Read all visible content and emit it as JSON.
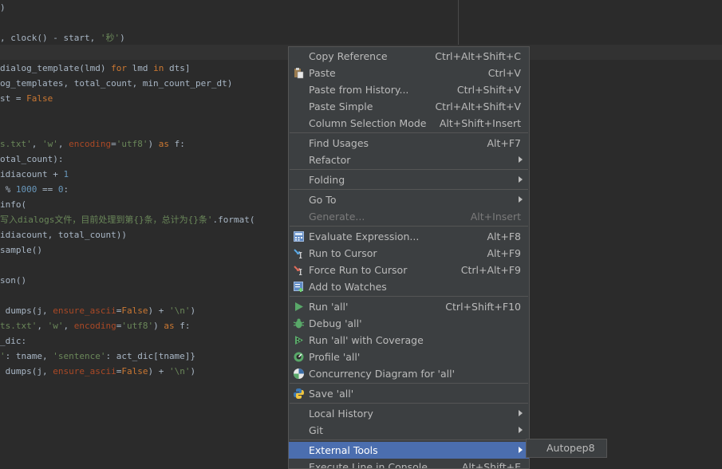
{
  "code_lines": [
    [
      {
        "t": ")",
        "c": "op"
      }
    ],
    [],
    [
      {
        "t": ", clock() - start, ",
        "c": "op"
      },
      {
        "t": "'秒'",
        "c": "str"
      },
      {
        "t": ")",
        "c": "op"
      }
    ],
    [],
    [
      {
        "t": "dialog_template(lmd) ",
        "c": "op"
      },
      {
        "t": "for",
        "c": "kw"
      },
      {
        "t": " lmd ",
        "c": "op"
      },
      {
        "t": "in",
        "c": "kw"
      },
      {
        "t": " dts]",
        "c": "op"
      }
    ],
    [
      {
        "t": "og_templates, total_count, min_count_per_dt)",
        "c": "op"
      }
    ],
    [
      {
        "t": "st = ",
        "c": "op"
      },
      {
        "t": "False",
        "c": "kw"
      }
    ],
    [],
    [],
    [
      {
        "t": "s.txt'",
        "c": "str"
      },
      {
        "t": ", ",
        "c": "op"
      },
      {
        "t": "'w'",
        "c": "str"
      },
      {
        "t": ", ",
        "c": "op"
      },
      {
        "t": "encoding",
        "c": "kwarg"
      },
      {
        "t": "=",
        "c": "op"
      },
      {
        "t": "'utf8'",
        "c": "str"
      },
      {
        "t": ") ",
        "c": "op"
      },
      {
        "t": "as",
        "c": "kw"
      },
      {
        "t": " f:",
        "c": "op"
      }
    ],
    [
      {
        "t": "otal_count):",
        "c": "op"
      }
    ],
    [
      {
        "t": "idiacount + ",
        "c": "op"
      },
      {
        "t": "1",
        "c": "num"
      }
    ],
    [
      {
        "t": " % ",
        "c": "op"
      },
      {
        "t": "1000",
        "c": "num"
      },
      {
        "t": " == ",
        "c": "op"
      },
      {
        "t": "0",
        "c": "num"
      },
      {
        "t": ":",
        "c": "op"
      }
    ],
    [
      {
        "t": "info(",
        "c": "op"
      }
    ],
    [
      {
        "t": "写入dialogs文件，目前处理到第{}条，总计为{}条'",
        "c": "str"
      },
      {
        "t": ".format(",
        "c": "op"
      }
    ],
    [
      {
        "t": "idiacount, total_count))",
        "c": "op"
      }
    ],
    [
      {
        "t": "sample()",
        "c": "op"
      }
    ],
    [],
    [
      {
        "t": "son()",
        "c": "op"
      }
    ],
    [],
    [
      {
        "t": " dumps(j, ",
        "c": "op"
      },
      {
        "t": "ensure_ascii",
        "c": "kwarg"
      },
      {
        "t": "=",
        "c": "op"
      },
      {
        "t": "False",
        "c": "kw"
      },
      {
        "t": ") + ",
        "c": "op"
      },
      {
        "t": "'\\n'",
        "c": "str"
      },
      {
        "t": ")",
        "c": "op"
      }
    ],
    [
      {
        "t": "ts.txt'",
        "c": "str"
      },
      {
        "t": ", ",
        "c": "op"
      },
      {
        "t": "'w'",
        "c": "str"
      },
      {
        "t": ", ",
        "c": "op"
      },
      {
        "t": "encoding",
        "c": "kwarg"
      },
      {
        "t": "=",
        "c": "op"
      },
      {
        "t": "'utf8'",
        "c": "str"
      },
      {
        "t": ") ",
        "c": "op"
      },
      {
        "t": "as",
        "c": "kw"
      },
      {
        "t": " f:",
        "c": "op"
      }
    ],
    [
      {
        "t": "_dic:",
        "c": "op"
      }
    ],
    [
      {
        "t": "'",
        "c": "str"
      },
      {
        "t": ": tname, ",
        "c": "op"
      },
      {
        "t": "'sentence'",
        "c": "str"
      },
      {
        "t": ": act_dic[tname]}",
        "c": "op"
      }
    ],
    [
      {
        "t": " dumps(j, ",
        "c": "op"
      },
      {
        "t": "ensure_ascii",
        "c": "kwarg"
      },
      {
        "t": "=",
        "c": "op"
      },
      {
        "t": "False",
        "c": "kw"
      },
      {
        "t": ") + ",
        "c": "op"
      },
      {
        "t": "'\\n'",
        "c": "str"
      },
      {
        "t": ")",
        "c": "op"
      }
    ]
  ],
  "menu": {
    "items": [
      {
        "label": "Copy Reference",
        "shortcut": "Ctrl+Alt+Shift+C"
      },
      {
        "label": "Paste",
        "shortcut": "Ctrl+V",
        "icon": "paste-icon"
      },
      {
        "label": "Paste from History...",
        "shortcut": "Ctrl+Shift+V"
      },
      {
        "label": "Paste Simple",
        "shortcut": "Ctrl+Alt+Shift+V"
      },
      {
        "label": "Column Selection Mode",
        "shortcut": "Alt+Shift+Insert"
      },
      {
        "sep": true
      },
      {
        "label": "Find Usages",
        "shortcut": "Alt+F7"
      },
      {
        "label": "Refactor",
        "submenu": true
      },
      {
        "sep": true
      },
      {
        "label": "Folding",
        "submenu": true
      },
      {
        "sep": true
      },
      {
        "label": "Go To",
        "submenu": true
      },
      {
        "label": "Generate...",
        "shortcut": "Alt+Insert",
        "disabled": true
      },
      {
        "sep": true
      },
      {
        "label": "Evaluate Expression...",
        "shortcut": "Alt+F8",
        "icon": "calculator-icon"
      },
      {
        "label": "Run to Cursor",
        "shortcut": "Alt+F9",
        "icon": "run-to-cursor-icon"
      },
      {
        "label": "Force Run to Cursor",
        "shortcut": "Ctrl+Alt+F9",
        "icon": "force-run-to-cursor-icon"
      },
      {
        "label": "Add to Watches",
        "icon": "watches-icon"
      },
      {
        "sep": true
      },
      {
        "label": "Run 'all'",
        "shortcut": "Ctrl+Shift+F10",
        "icon": "run-icon"
      },
      {
        "label": "Debug 'all'",
        "icon": "debug-icon"
      },
      {
        "label": "Run 'all' with Coverage",
        "icon": "coverage-icon"
      },
      {
        "label": "Profile 'all'",
        "icon": "profile-icon"
      },
      {
        "label": "Concurrency Diagram for  'all'",
        "icon": "concurrency-icon"
      },
      {
        "sep": true
      },
      {
        "label": "Save 'all'",
        "icon": "python-icon"
      },
      {
        "sep": true
      },
      {
        "label": "Local History",
        "submenu": true
      },
      {
        "label": "Git",
        "submenu": true
      },
      {
        "sep": true
      },
      {
        "label": "External Tools",
        "submenu": true,
        "selected": true
      },
      {
        "label": "Execute Line in Console",
        "shortcut": "Alt+Shift+E"
      }
    ]
  },
  "submenu": {
    "items": [
      {
        "label": "Autopep8"
      }
    ]
  },
  "colors": {
    "selection": "#4b6eaf",
    "menu_bg": "#3c3f41",
    "editor_bg": "#2b2b2b"
  }
}
